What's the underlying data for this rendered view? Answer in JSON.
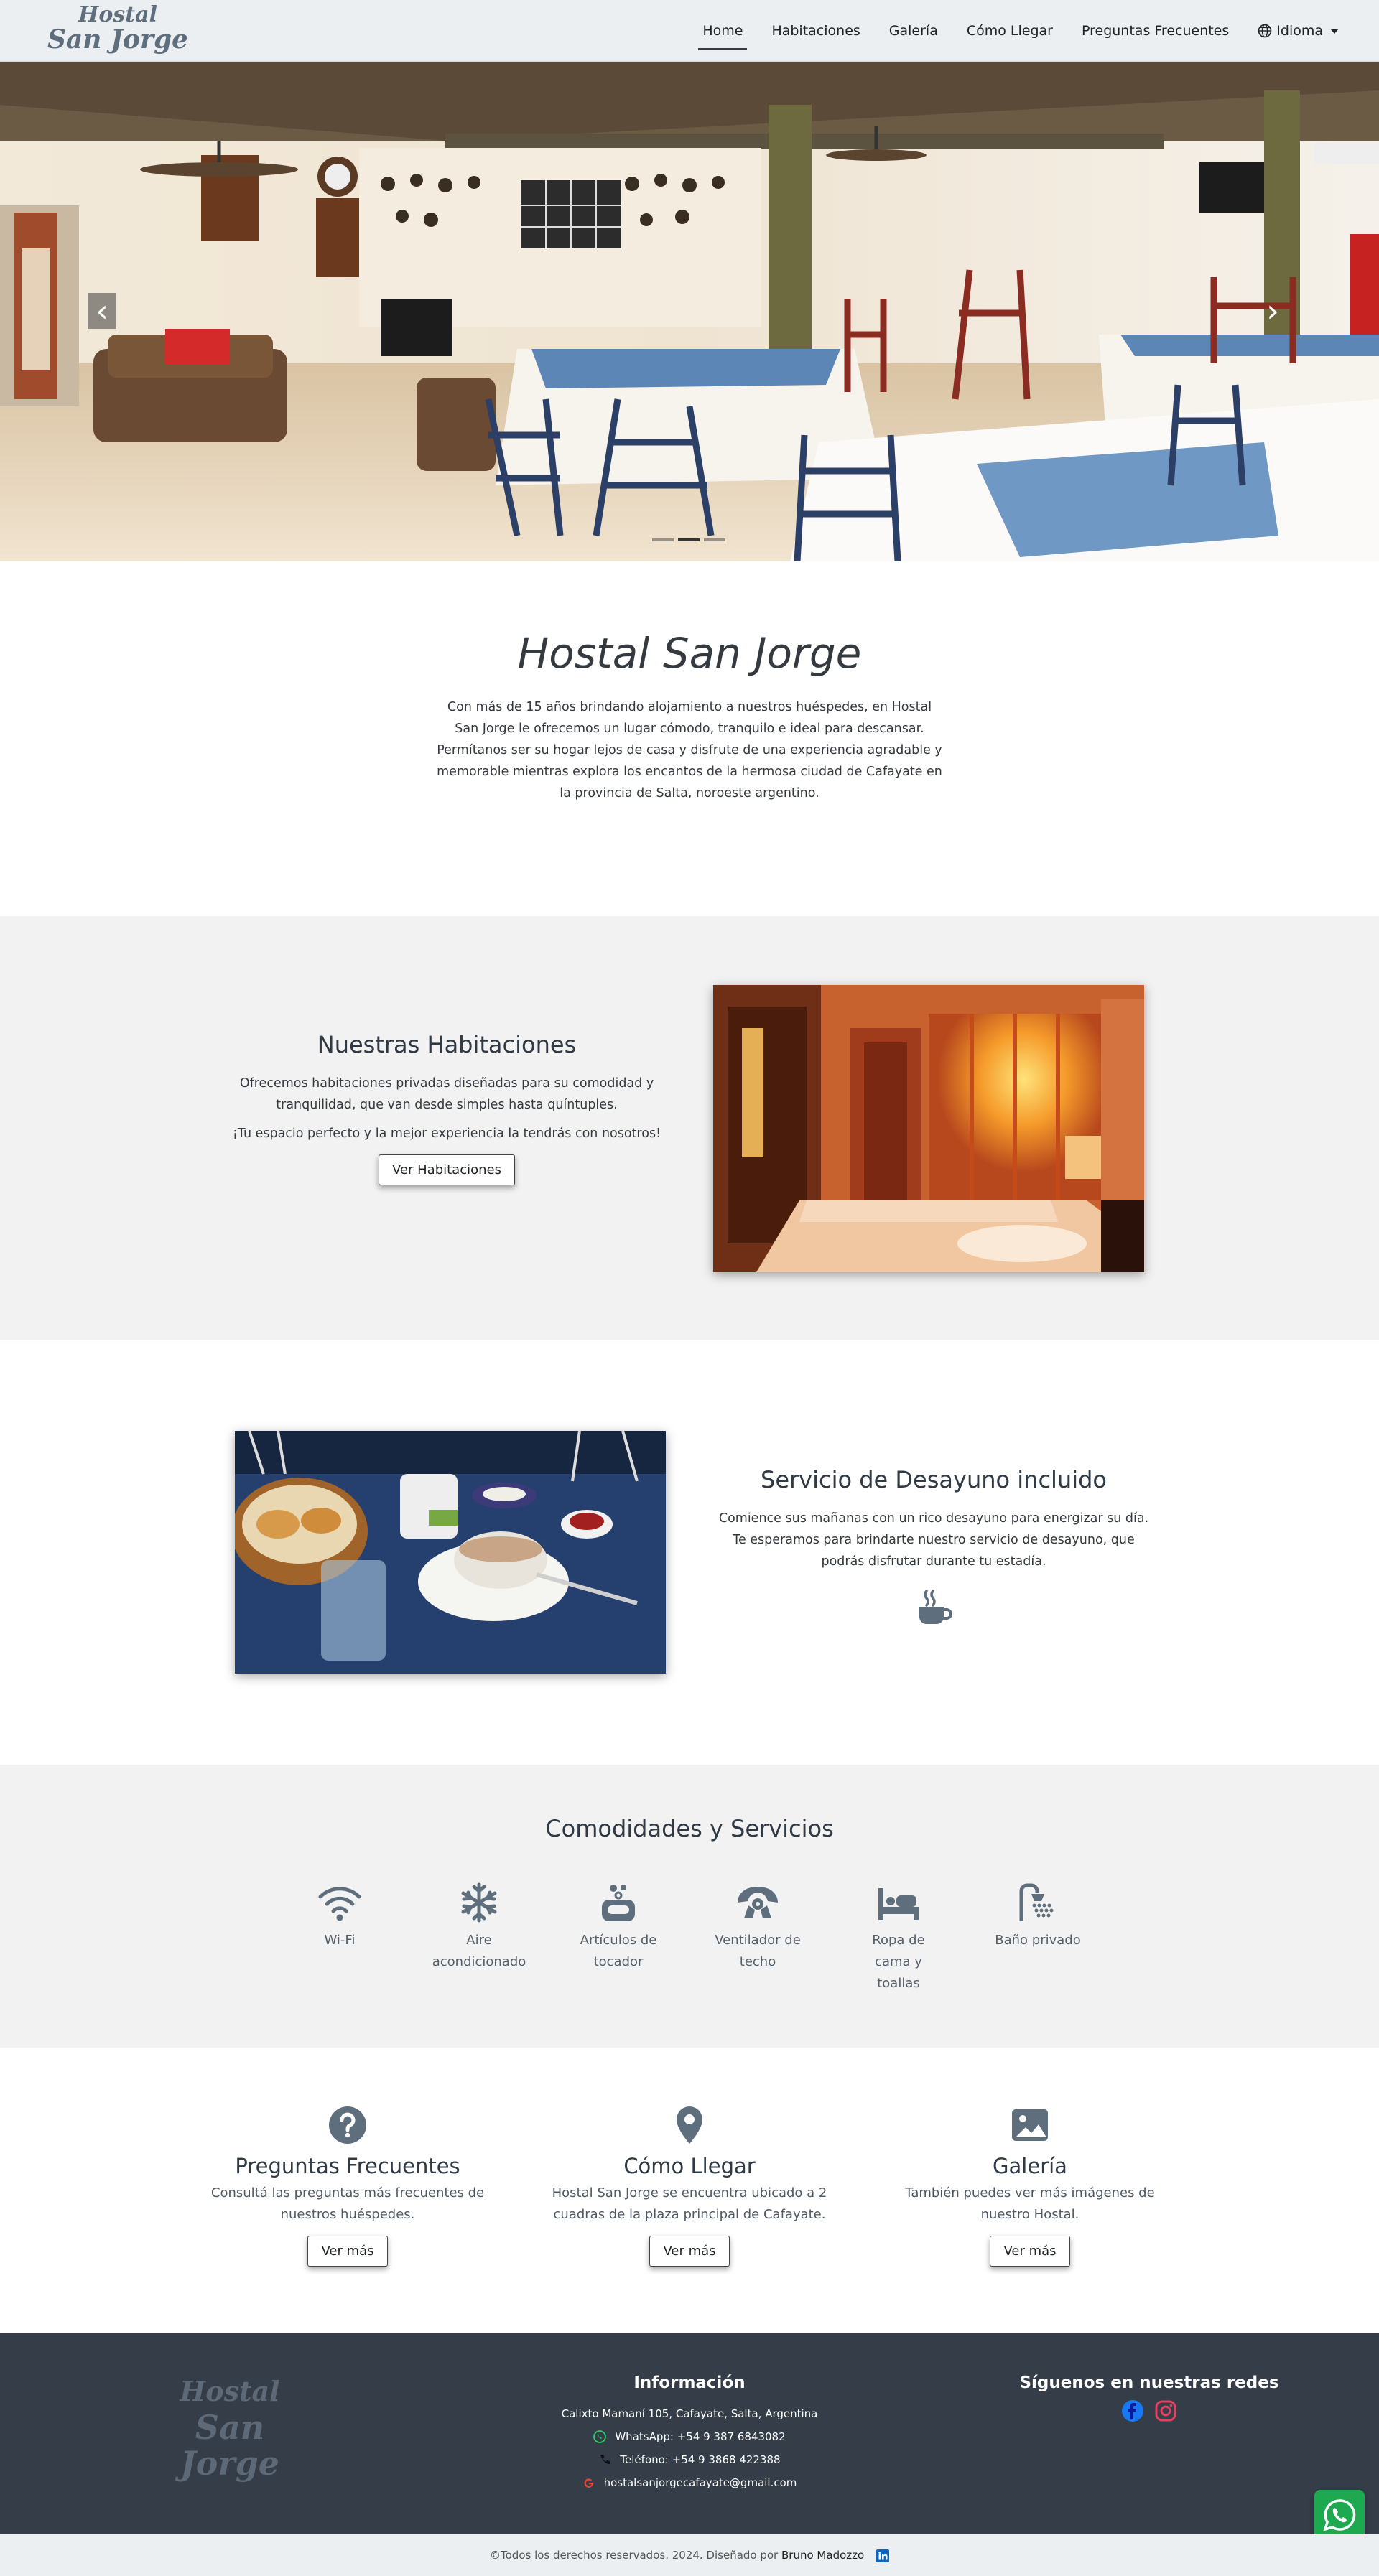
{
  "brand": {
    "line1": "Hostal",
    "line2": "San Jorge"
  },
  "nav": {
    "items": [
      {
        "label": "Home",
        "active": true
      },
      {
        "label": "Habitaciones"
      },
      {
        "label": "Galería"
      },
      {
        "label": "Cómo Llegar"
      },
      {
        "label": "Preguntas Frecuentes"
      }
    ],
    "language": "Idioma"
  },
  "carousel": {
    "prev": "‹",
    "next": "›",
    "slides": 3,
    "active_slide": 2
  },
  "intro": {
    "title": "Hostal San Jorge",
    "text": "Con más de 15 años brindando alojamiento a nuestros huéspedes, en Hostal San Jorge le ofrecemos un lugar cómodo, tranquilo e ideal para descansar. Permítanos ser su hogar lejos de casa y disfrute de una experiencia agradable y memorable mientras explora los encantos de la hermosa ciudad de Cafayate en la provincia de Salta, noroeste argentino."
  },
  "rooms": {
    "title": "Nuestras Habitaciones",
    "text1": "Ofrecemos habitaciones privadas diseñadas para su comodidad y tranquilidad, que van desde simples hasta quíntuples.",
    "text2": "¡Tu espacio perfecto y la mejor experiencia la tendrás con nosotros!",
    "button": "Ver Habitaciones"
  },
  "breakfast": {
    "title": "Servicio de Desayuno incluido",
    "text": "Comience sus mañanas con un rico desayuno para energizar su día. Te esperamos para brindarte nuestro servicio de desayuno, que podrás disfrutar durante tu estadía."
  },
  "amenities": {
    "title": "Comodidades y Servicios",
    "items": [
      {
        "label": "Wi-Fi",
        "icon": "wifi-icon"
      },
      {
        "label": "Aire acondicionado",
        "icon": "snowflake-icon"
      },
      {
        "label": "Artículos de tocador",
        "icon": "soap-icon"
      },
      {
        "label": "Ventilador de techo",
        "icon": "fan-icon"
      },
      {
        "label": "Ropa de cama y toallas",
        "icon": "bed-icon"
      },
      {
        "label": "Baño privado",
        "icon": "shower-icon"
      }
    ]
  },
  "links": [
    {
      "title": "Preguntas Frecuentes",
      "text": "Consultá las preguntas más frecuentes de nuestros huéspedes.",
      "button": "Ver más",
      "icon": "question-icon"
    },
    {
      "title": "Cómo Llegar",
      "text": "Hostal San Jorge se encuentra ubicado a 2 cuadras de la plaza principal de Cafayate.",
      "button": "Ver más",
      "icon": "map-pin-icon"
    },
    {
      "title": "Galería",
      "text": "También puedes ver más imágenes de nuestro Hostal.",
      "button": "Ver más",
      "icon": "image-icon"
    }
  ],
  "footer": {
    "info_title": "Información",
    "address": "Calixto Mamaní 105, Cafayate, Salta, Argentina",
    "whatsapp": "WhatsApp: +54 9 387 6843082",
    "phone": "Teléfono: +54 9 3868 422388",
    "email": "hostalsanjorgecafayate@gmail.com",
    "social_title": "Síguenos en nuestras redes"
  },
  "copyright": {
    "text": "©Todos los derechos reservados. 2024. Diseñado por",
    "author": "Bruno Madozzo"
  },
  "colors": {
    "navbar": "#eceff2",
    "section_gray": "#f2f2f2",
    "footer": "#343d48",
    "whatsapp": "#1ea84f",
    "facebook": "#1877f2",
    "instagram": "#e4405f"
  }
}
